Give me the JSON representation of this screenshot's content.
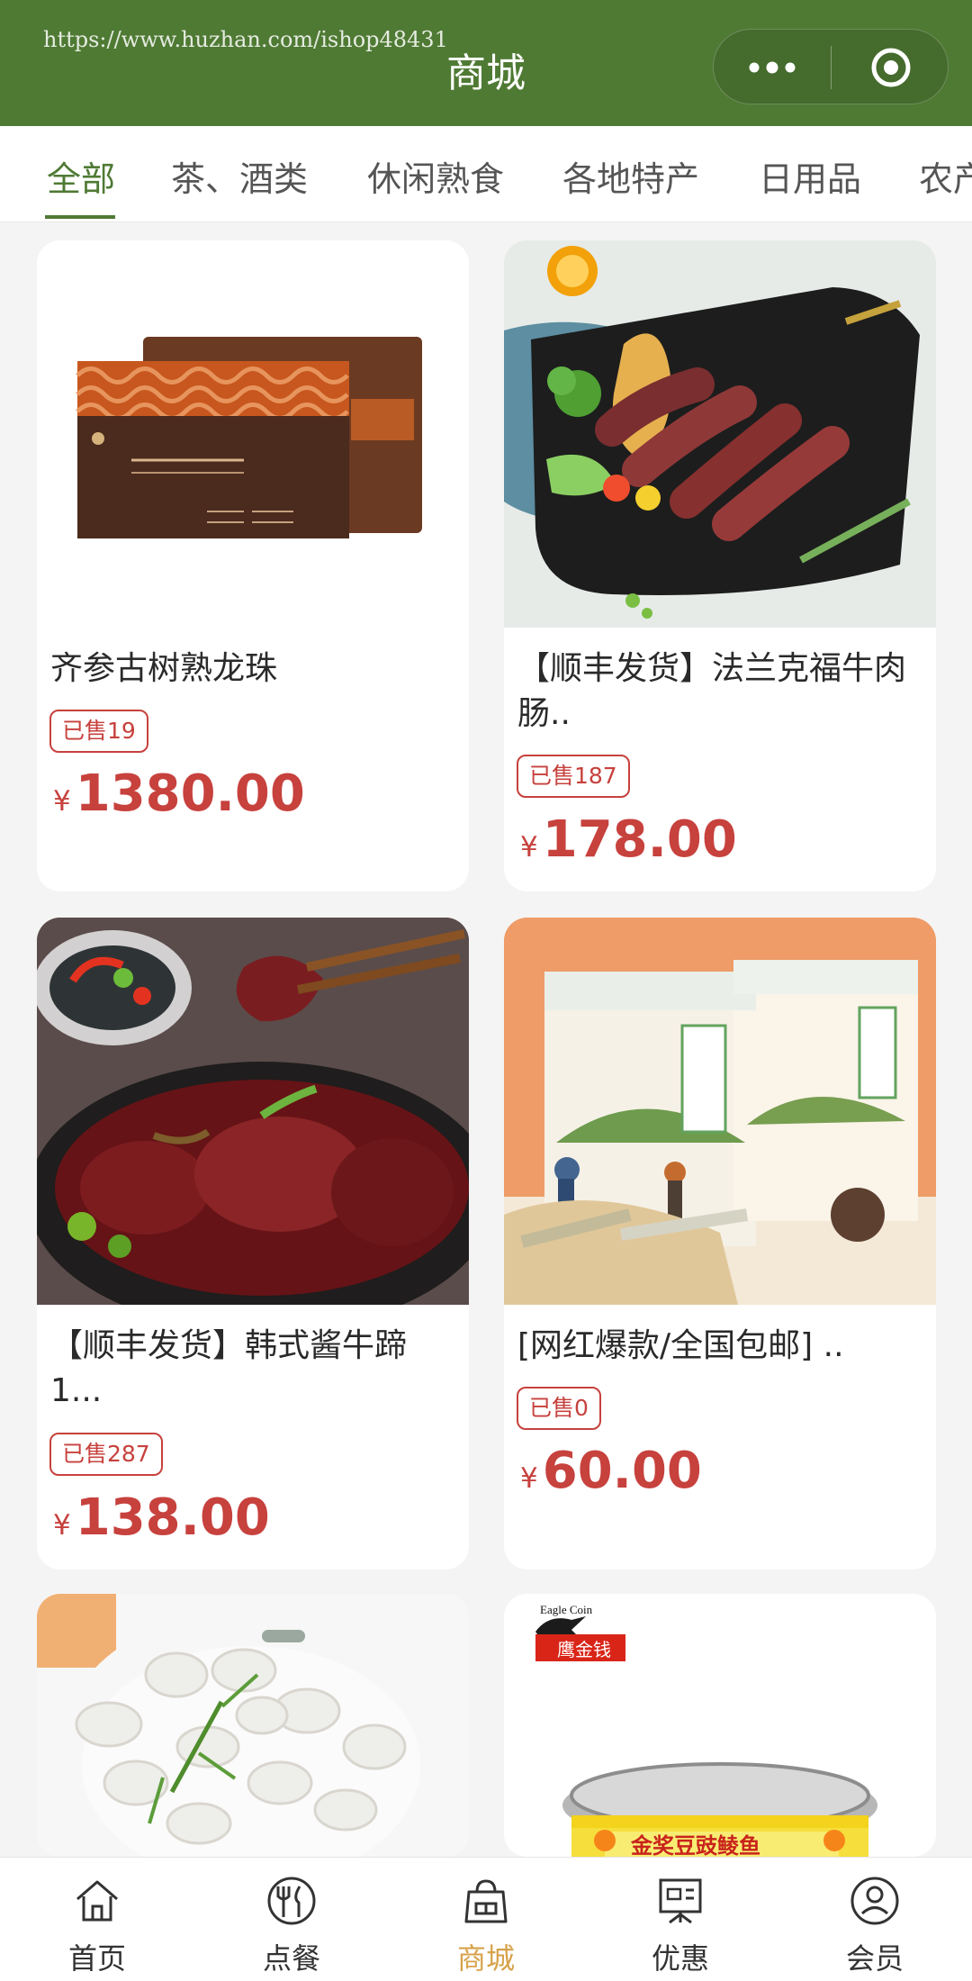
{
  "app": {
    "watermark": "https://www.huzhan.com/ishop48431",
    "title": "商城",
    "accent": "#4f7a34",
    "price_color": "#c7413d"
  },
  "tabs": [
    {
      "label": "全部",
      "active": true
    },
    {
      "label": "茶、酒类",
      "active": false
    },
    {
      "label": "休闲熟食",
      "active": false
    },
    {
      "label": "各地特产",
      "active": false
    },
    {
      "label": "日用品",
      "active": false
    },
    {
      "label": "农产",
      "active": false
    }
  ],
  "products": [
    {
      "title": "齐参古树熟龙珠",
      "sold": "已售19",
      "currency": "¥",
      "price": "1380.00",
      "image": "gift-box"
    },
    {
      "title": "【顺丰发货】法兰克福牛肉肠..",
      "sold": "已售187",
      "currency": "¥",
      "price": "178.00",
      "image": "sausages"
    },
    {
      "title": "【顺丰发货】韩式酱牛蹄1...",
      "sold": "已售287",
      "currency": "¥",
      "price": "138.00",
      "image": "braised-beef-hoof"
    },
    {
      "title": "[网红爆款/全国包邮] ..",
      "sold": "已售0",
      "currency": "¥",
      "price": "60.00",
      "image": "corn-gift-box"
    },
    {
      "title": "",
      "sold": "",
      "currency": "",
      "price": "",
      "image": "dumplings"
    },
    {
      "title": "",
      "sold": "",
      "currency": "",
      "price": "",
      "image": "canned-fish",
      "brand": "Eagle Coin",
      "brand_cn": "鹰金钱",
      "can_label": "金奖豆豉鲮鱼"
    }
  ],
  "bottom_nav": [
    {
      "label": "首页",
      "icon": "home-icon",
      "active": false
    },
    {
      "label": "点餐",
      "icon": "dining-icon",
      "active": false
    },
    {
      "label": "商城",
      "icon": "shop-bag-icon",
      "active": true
    },
    {
      "label": "优惠",
      "icon": "coupon-icon",
      "active": false
    },
    {
      "label": "会员",
      "icon": "member-icon",
      "active": false
    }
  ]
}
